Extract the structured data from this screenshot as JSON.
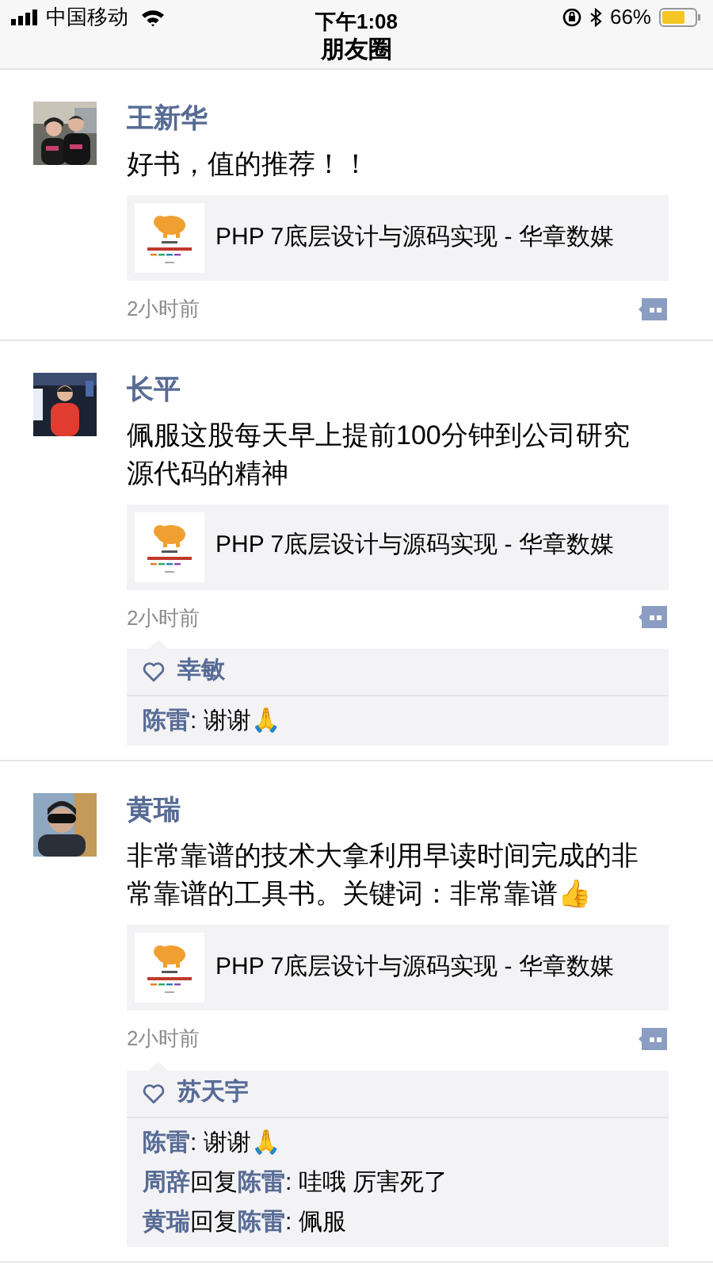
{
  "status_bar": {
    "carrier": "中国移动",
    "time": "下午1:08",
    "battery": "66%"
  },
  "nav": {
    "title": "朋友圈"
  },
  "posts": [
    {
      "author": "王新华",
      "text": "好书，值的推荐！！",
      "link": {
        "title": "PHP 7底层设计与源码实现 - 华章数媒"
      },
      "time": "2小时前"
    },
    {
      "author": "长平",
      "text": "佩服这股每天早上提前100分钟到公司研究源代码的精神",
      "link": {
        "title": "PHP 7底层设计与源码实现 - 华章数媒"
      },
      "time": "2小时前",
      "likes": [
        "幸敏"
      ],
      "comments": [
        {
          "author": "陈雷",
          "text": ": 谢谢🙏"
        }
      ]
    },
    {
      "author": "黄瑞",
      "text": "非常靠谱的技术大拿利用早读时间完成的非常靠谱的工具书。关键词：非常靠谱👍",
      "link": {
        "title": "PHP 7底层设计与源码实现 - 华章数媒"
      },
      "time": "2小时前",
      "likes": [
        "苏天宇"
      ],
      "comments": [
        {
          "author": "陈雷",
          "text": ": 谢谢🙏"
        },
        {
          "author": "周辞",
          "reply_word": "回复",
          "reply_to": "陈雷",
          "text": ": 哇哦 厉害死了"
        },
        {
          "author": "黄瑞",
          "reply_word": "回复",
          "reply_to": "陈雷",
          "text": ": 佩服"
        }
      ]
    }
  ]
}
